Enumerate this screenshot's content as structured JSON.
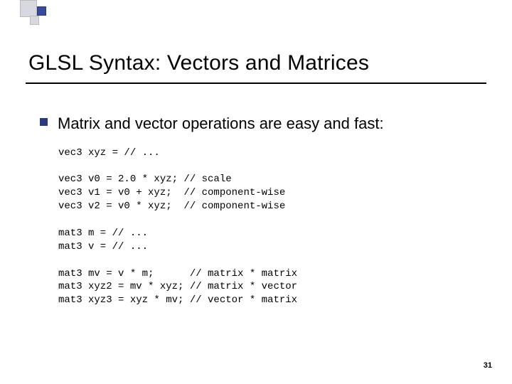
{
  "title": "GLSL Syntax:  Vectors and Matrices",
  "bullet": "Matrix and vector operations are easy and fast:",
  "code": "vec3 xyz = // ...\n\nvec3 v0 = 2.0 * xyz; // scale\nvec3 v1 = v0 + xyz;  // component-wise\nvec3 v2 = v0 * xyz;  // component-wise\n\nmat3 m = // ...\nmat3 v = // ...\n\nmat3 mv = v * m;      // matrix * matrix\nmat3 xyz2 = mv * xyz; // matrix * vector\nmat3 xyz3 = xyz * mv; // vector * matrix",
  "page_number": "31"
}
